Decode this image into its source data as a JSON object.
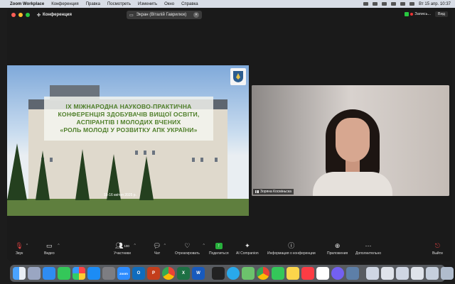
{
  "menubar": {
    "app_name": "Zoom Workplace",
    "items": [
      "Конференция",
      "Правка",
      "Посмотреть",
      "Изменить",
      "Окно",
      "Справка"
    ],
    "clock": "Вт 15 апр.  10:37"
  },
  "titlebar": {
    "conference_label": "Конференция",
    "share_label": "Экран (Віталій Гаврилюк)",
    "record_label": "Запись...",
    "view_label": "Вид"
  },
  "slide": {
    "line1": "IX МІЖНАРОДНА НАУКОВО-ПРАКТИЧНА",
    "line2": "КОНФЕРЕНЦІЯ ЗДОБУВАЧІВ ВИЩОЇ ОСВІТИ,",
    "line3": "АСПІРАНТІВ І МОЛОДИХ ВЧЕНИХ",
    "line4": "«РОЛЬ МОЛОДІ У РОЗВИТКУ АПК УКРАЇНИ»",
    "date": "15-16 квітня 2025 р."
  },
  "video": {
    "participant_name": "Зоряна Косміньска"
  },
  "toolbar": {
    "mute": "Звук",
    "video": "Видео",
    "participants": "Участники",
    "participants_count": "100",
    "chat": "Чат",
    "react": "Отреагировать",
    "share": "Поделиться",
    "ai": "AI Companion",
    "info": "Информация о конференции",
    "apps": "Приложения",
    "more": "Дополнительно",
    "leave": "Выйти"
  },
  "dock": {
    "icons": [
      "finder-icon",
      "launchpad-icon",
      "safari-icon",
      "facetime-icon",
      "photos-icon",
      "appstore-icon",
      "settings-icon",
      "zoom-icon",
      "outlook-icon",
      "powerpoint-icon",
      "chrome-icon",
      "excel-icon",
      "word-icon",
      "terminal-icon",
      "telegram-icon",
      "maps-icon",
      "chrome-icon",
      "messages-icon",
      "notes-icon",
      "music-icon",
      "calendar-icon",
      "viber-icon",
      "preview-icon",
      "trash-icon"
    ],
    "zoom_label": "zoom"
  },
  "colors": {
    "banner_text": "#4f7f2a",
    "leave": "#e04040",
    "share_green": "#27b03c"
  }
}
